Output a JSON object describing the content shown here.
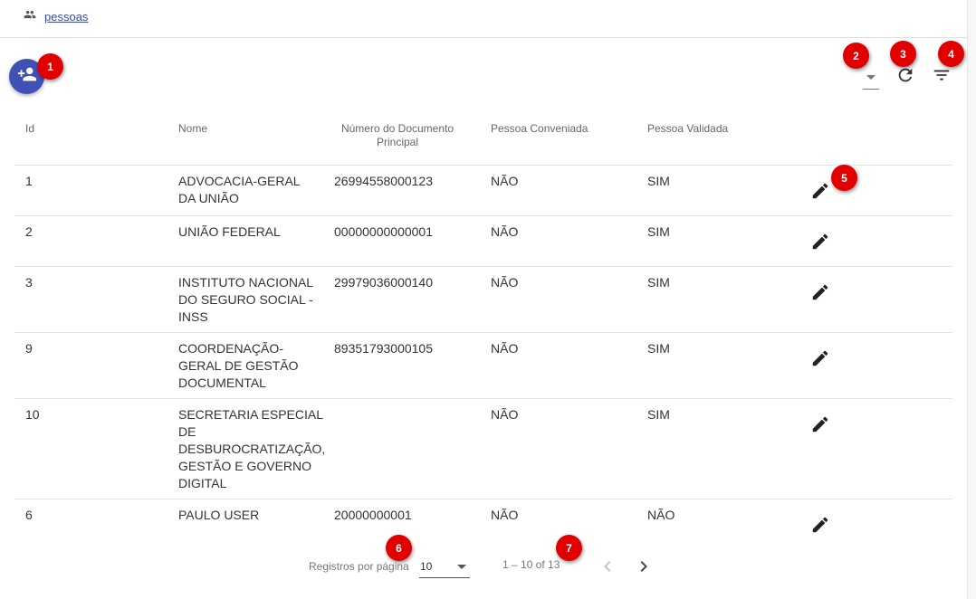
{
  "breadcrumb": {
    "icon": "people-icon",
    "label": "pessoas"
  },
  "toolbar": {
    "add_icon": "person-add-icon",
    "refresh_icon": "refresh-icon",
    "filter_icon": "filter-list-icon"
  },
  "badges": [
    "1",
    "2",
    "3",
    "4",
    "5",
    "6",
    "7"
  ],
  "table": {
    "headers": {
      "id": "Id",
      "nome": "Nome",
      "documento_line1": "Número do Documento",
      "documento_line2": "Principal",
      "conveniada": "Pessoa Conveniada",
      "validada": "Pessoa Validada"
    },
    "rows": [
      {
        "id": "1",
        "nome_lines": [
          "ADVOCACIA-GERAL",
          "DA UNIÃO"
        ],
        "documento": "26994558000123",
        "conveniada": "NÃO",
        "validada": "SIM"
      },
      {
        "id": "2",
        "nome_lines": [
          "UNIÃO FEDERAL"
        ],
        "documento": "00000000000001",
        "conveniada": "NÃO",
        "validada": "SIM"
      },
      {
        "id": "3",
        "nome_lines": [
          "INSTITUTO NACIONAL",
          "DO SEGURO SOCIAL -",
          "INSS"
        ],
        "documento": "29979036000140",
        "conveniada": "NÃO",
        "validada": "SIM"
      },
      {
        "id": "9",
        "nome_lines": [
          "COORDENAÇÃO-",
          "GERAL DE GESTÃO",
          "DOCUMENTAL"
        ],
        "documento": "89351793000105",
        "conveniada": "NÃO",
        "validada": "SIM"
      },
      {
        "id": "10",
        "nome_lines": [
          "SECRETARIA ESPECIAL",
          "DE",
          "DESBUROCRATIZAÇÃO,",
          "GESTÃO E GOVERNO",
          "DIGITAL"
        ],
        "documento": "",
        "conveniada": "NÃO",
        "validada": "SIM"
      },
      {
        "id": "6",
        "nome_lines": [
          "PAULO USER"
        ],
        "documento": "20000000001",
        "conveniada": "NÃO",
        "validada": "NÃO"
      }
    ],
    "edit_icon": "pencil-icon"
  },
  "pagination": {
    "label": "Registros por página",
    "page_size": "10",
    "range": "1 – 10 of 13",
    "prev_icon": "chevron-left-icon",
    "next_icon": "chevron-right-icon",
    "prev_color": "#c4c4c4",
    "next_color": "#444444"
  },
  "colors": {
    "accent": "#3f51b5",
    "badge": "#e00000"
  }
}
